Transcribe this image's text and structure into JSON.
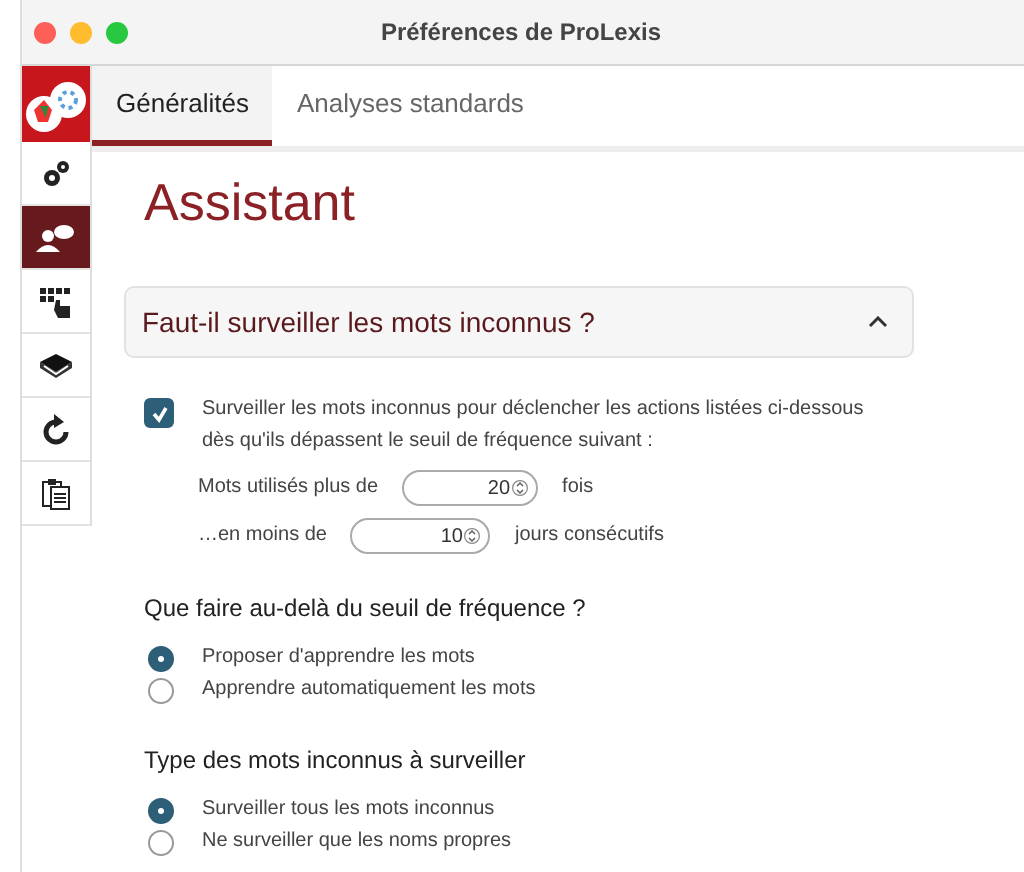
{
  "window": {
    "title": "Préférences de ProLexis"
  },
  "sidebar": {
    "items": [
      {
        "selected": false
      },
      {
        "selected": true
      },
      {
        "selected": false
      },
      {
        "selected": false
      },
      {
        "selected": false
      },
      {
        "selected": false
      }
    ]
  },
  "tabs": [
    {
      "label": "Généralités",
      "selected": true
    },
    {
      "label": "Analyses standards",
      "selected": false
    }
  ],
  "heading": "Assistant",
  "section": {
    "title": "Faut-il surveiller les mots inconnus ?",
    "expanded": true
  },
  "monitor": {
    "label": "Surveiller les mots inconnus pour déclencher les actions listées ci-dessous dès qu'ils dépassent le seuil de fréquence suivant :",
    "checked": true
  },
  "thresholds": [
    {
      "label": "Mots utilisés plus de",
      "value": "20",
      "unit": "fois"
    },
    {
      "label": "…en moins de",
      "value": "10",
      "unit": "jours consécutifs"
    }
  ],
  "groups": [
    {
      "title": "Que faire au-delà du seuil de fréquence ?",
      "options": [
        {
          "label": "Proposer d'apprendre les mots",
          "selected": true
        },
        {
          "label": "Apprendre automatiquement les mots",
          "selected": false
        }
      ]
    },
    {
      "title": "Type des mots inconnus à surveiller",
      "options": [
        {
          "label": "Surveiller tous les mots inconnus",
          "selected": true
        },
        {
          "label": "Ne surveiller que les noms propres",
          "selected": false
        }
      ]
    }
  ]
}
